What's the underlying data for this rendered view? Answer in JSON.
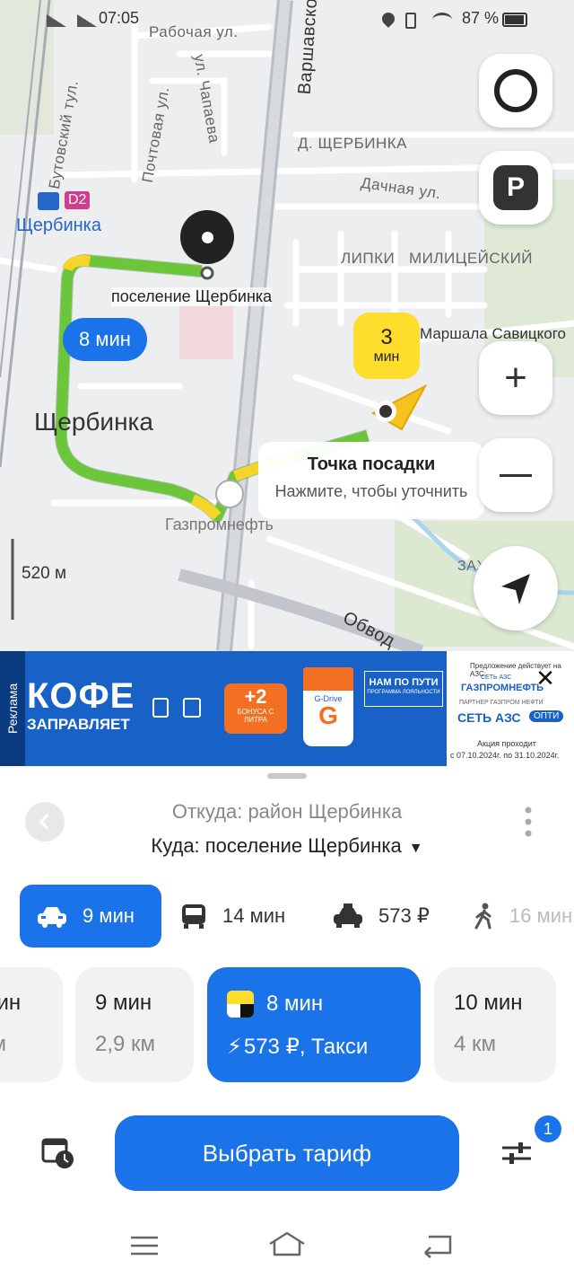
{
  "status_bar": {
    "time": "07:05",
    "battery": "87 %"
  },
  "map": {
    "labels": {
      "rabochaya": "Рабочая ул.",
      "varshavskoe": "Варшавско",
      "chapaeva": "ул. Чапаева",
      "pochtovaya": "Почтовая ул.",
      "butovsky": "Бутовский тул.",
      "d_shcherbinka": "Д. ЩЕРБИНКА",
      "dachnaya": "Дачная ул.",
      "station": "Щербинка",
      "station_badge": "D2",
      "lipki": "ЛИПКИ",
      "militseysky": "МИЛИЦЕЙСКИЙ",
      "savitskogo": "Маршала Савицкого",
      "district": "Щербинка",
      "gazpromneft": "Газпромнефть",
      "zakharyino": "ЗАХАРЬИНО",
      "obvod": "Обвод",
      "scale": "520 м"
    },
    "destination_label": "поселение Щербинка",
    "route_time": "8 мин",
    "eta": {
      "number": "3",
      "unit": "мин"
    },
    "pickup": {
      "title": "Точка посадки",
      "hint": "Нажмите, чтобы уточнить"
    }
  },
  "ad": {
    "tag": "Реклама",
    "headline": "КОФЕ",
    "subline": "ЗАПРАВЛЯЕТ",
    "bonus_value": "+2",
    "bonus_text": "БОНУСА С ЛИТРА",
    "cup_brand": "G-Drive",
    "program_title": "НАМ ПО ПУТИ",
    "program_sub": "ПРОГРАММА ЛОЯЛЬНОСТИ",
    "offer_note": "Предложение действует на АЗС:",
    "brand_top_small": "СЕТЬ АЗС",
    "brand_top": "ГАЗПРОМНЕФТЬ",
    "partner_note": "ПАРТНЕР ГАЗПРОМ НЕФТИ",
    "brand_bottom": "СЕТЬ АЗС",
    "brand_bottom_tag": "ОПТИ",
    "promo_line1": "Акция проходит",
    "promo_line2": "с 07.10.2024г. по 31.10.2024г."
  },
  "sheet": {
    "from": "Откуда: район Щербинка",
    "to": "Куда: поселение Щербинка",
    "modes": [
      {
        "label": "9 мин",
        "icon": "car-icon"
      },
      {
        "label": "14 мин",
        "icon": "bus-icon"
      },
      {
        "label": "573 ₽",
        "icon": "taxi-icon"
      },
      {
        "label": "16 мин",
        "icon": "walk-icon"
      }
    ],
    "cards": [
      {
        "time": "мин",
        "detail": "км"
      },
      {
        "time": "9 мин",
        "detail": "2,9 км"
      },
      {
        "time": "8 мин",
        "detail": "573 ₽, Такси"
      },
      {
        "time": "10 мин",
        "detail": "4 км"
      }
    ],
    "choose_label": "Выбрать тариф",
    "filter_badge": "1"
  },
  "colors": {
    "accent": "#1a73e8",
    "route_green": "#6bc63a",
    "route_yellow": "#f5d52a",
    "taxi_yellow": "#ffdd2d"
  }
}
